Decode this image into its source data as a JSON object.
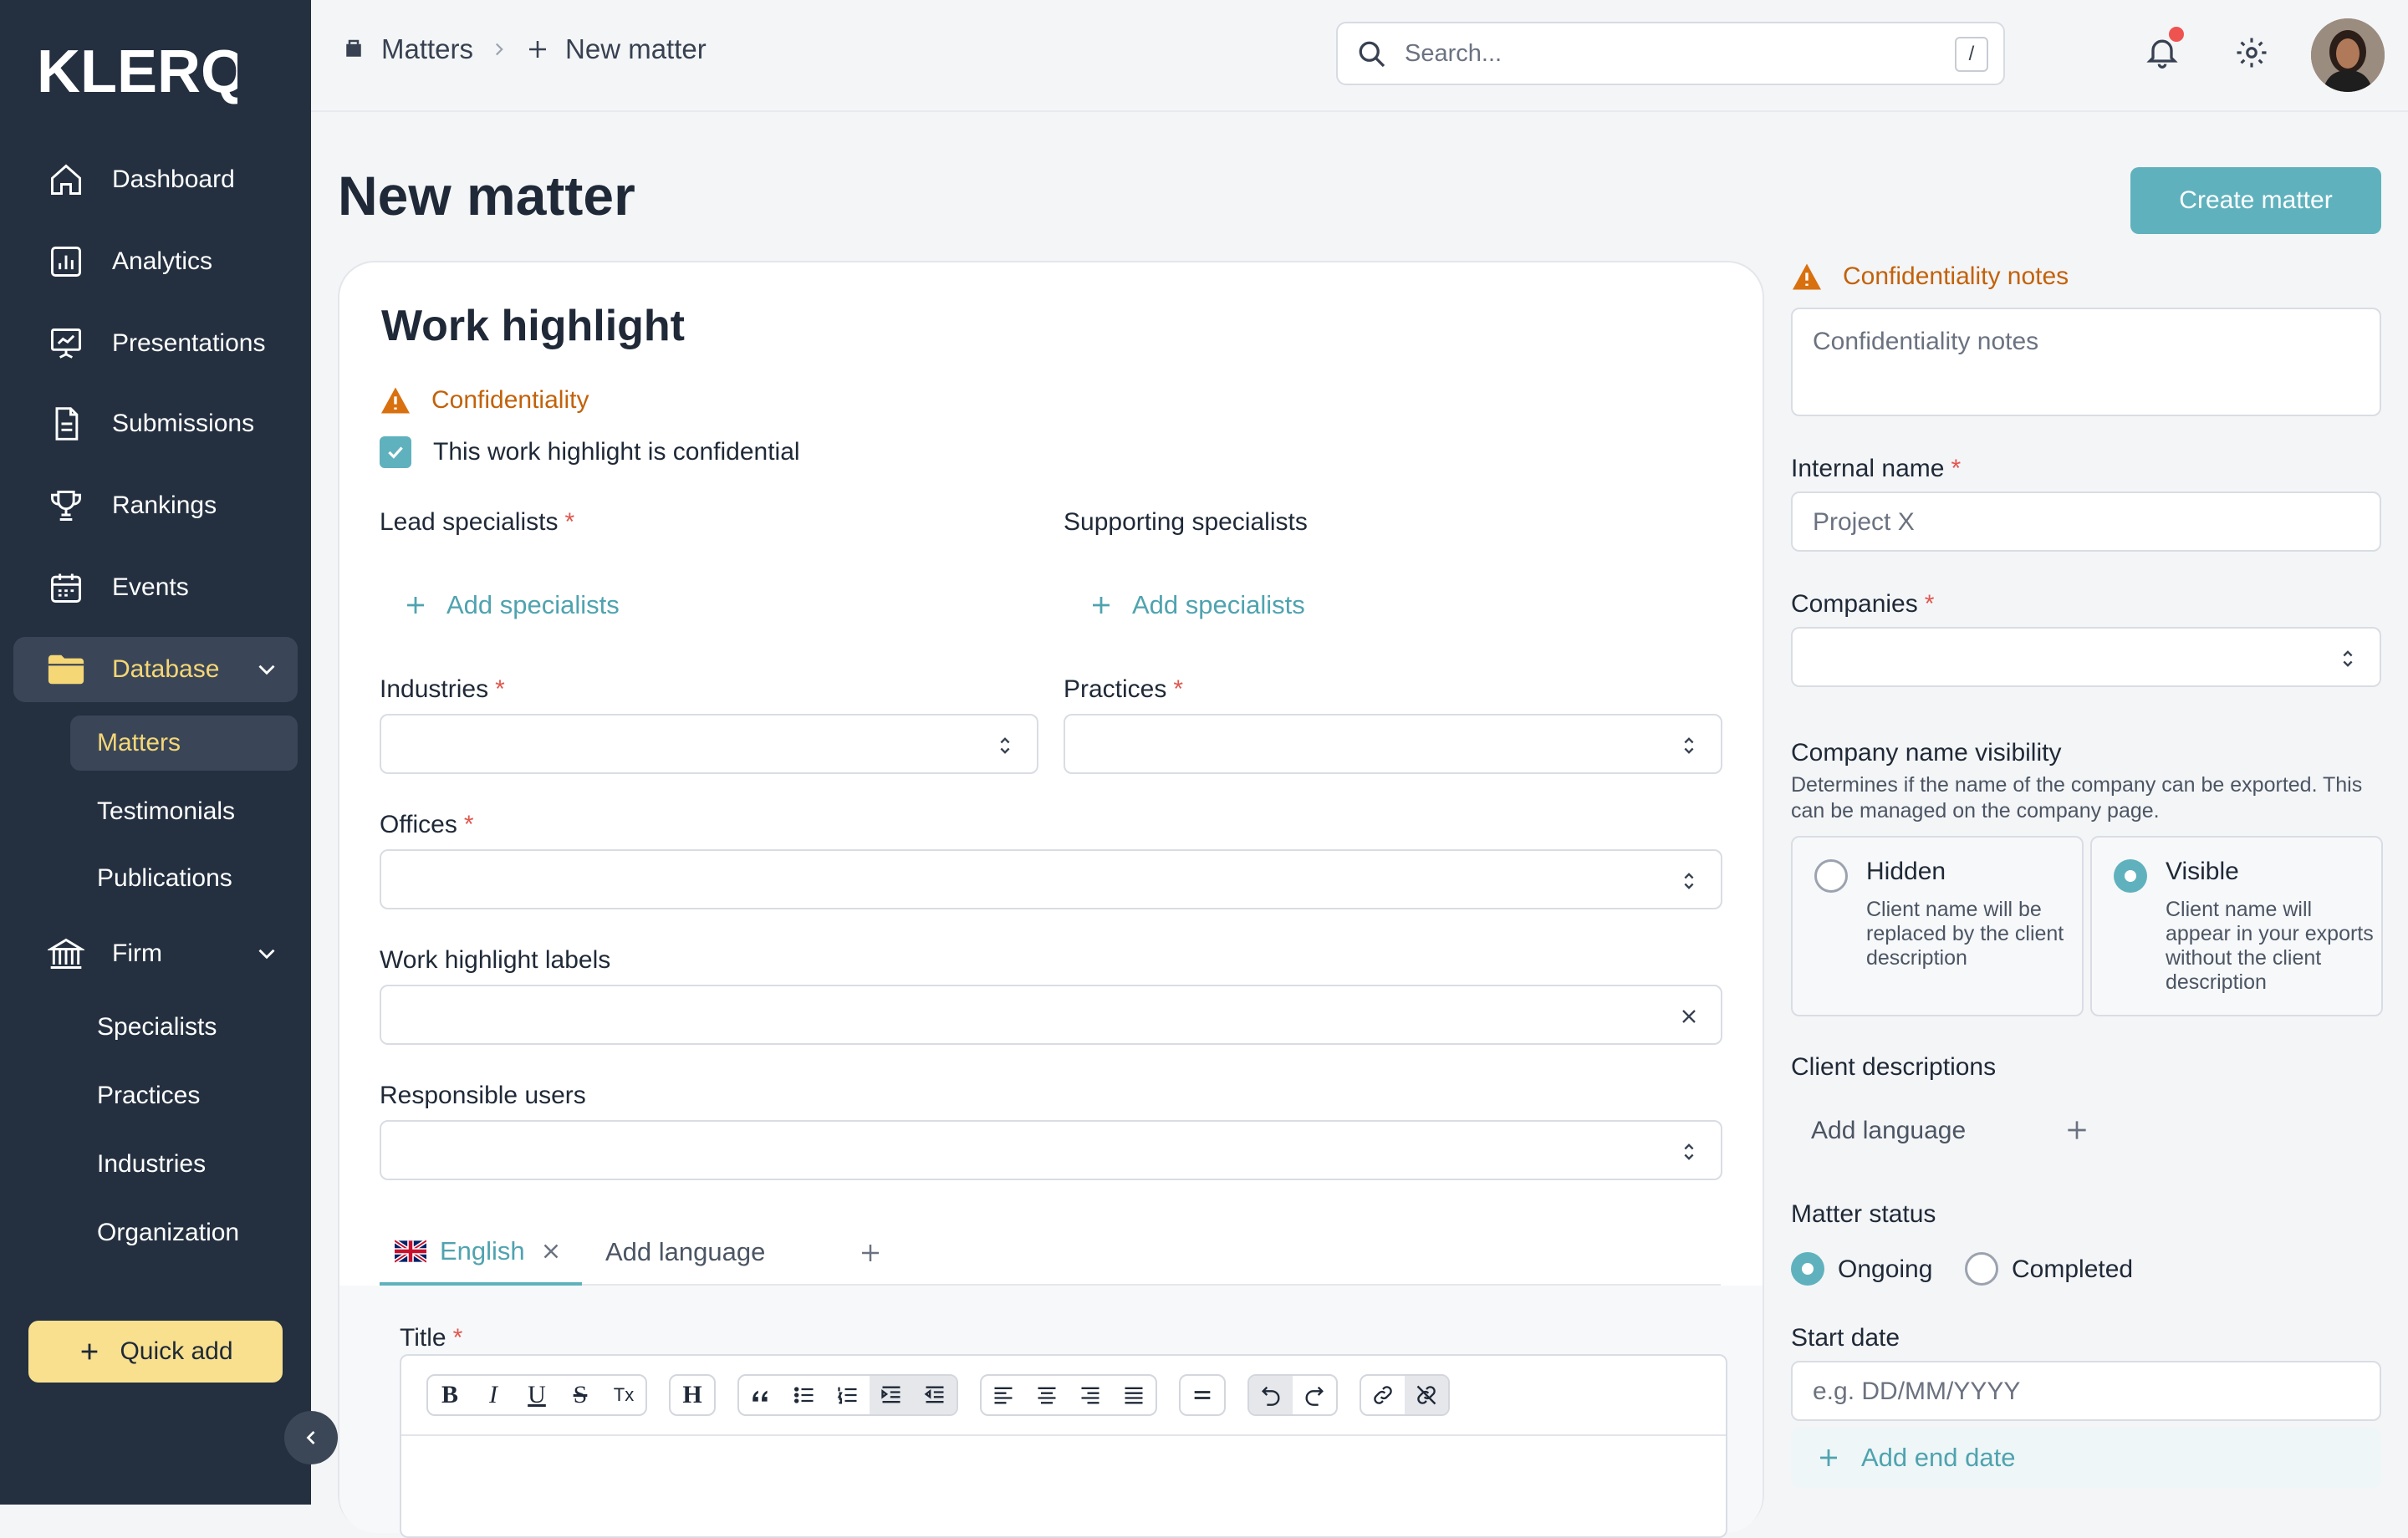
{
  "app": {
    "logo": "KLERQ"
  },
  "sidebar": {
    "items": [
      {
        "label": "Dashboard",
        "icon": "home-icon"
      },
      {
        "label": "Analytics",
        "icon": "analytics-icon"
      },
      {
        "label": "Presentations",
        "icon": "presentation-icon"
      },
      {
        "label": "Submissions",
        "icon": "document-icon"
      },
      {
        "label": "Rankings",
        "icon": "trophy-icon"
      },
      {
        "label": "Events",
        "icon": "calendar-icon"
      },
      {
        "label": "Database",
        "icon": "folder-icon"
      },
      {
        "label": "Firm",
        "icon": "bank-icon"
      }
    ],
    "database_sub": [
      "Matters",
      "Testimonials",
      "Publications"
    ],
    "firm_sub": [
      "Specialists",
      "Practices",
      "Industries",
      "Organization"
    ],
    "quick_add": "Quick add"
  },
  "breadcrumb": {
    "matters": "Matters",
    "new_matter": "New matter"
  },
  "search": {
    "placeholder": "Search...",
    "shortcut": "/"
  },
  "page": {
    "title": "New matter",
    "create_button": "Create matter"
  },
  "form": {
    "title": "Work highlight",
    "confidentiality": "Confidentiality",
    "confidential_checkbox": "This work highlight is confidential",
    "lead_specialists": "Lead specialists",
    "supporting_specialists": "Supporting specialists",
    "add_specialists": "Add specialists",
    "industries": "Industries",
    "practices": "Practices",
    "offices": "Offices",
    "work_highlight_labels": "Work highlight labels",
    "responsible_users": "Responsible users",
    "tab_english": "English",
    "add_language": "Add language",
    "title_label": "Title"
  },
  "editor_toolbar": [
    [
      "B",
      "I",
      "U",
      "S",
      "Tx"
    ],
    [
      "H"
    ],
    [
      "quote",
      "bullets",
      "numbers",
      "indent",
      "outdent"
    ],
    [
      "align-left",
      "align-center",
      "align-right",
      "justify"
    ],
    [
      "hr"
    ],
    [
      "undo",
      "redo"
    ],
    [
      "link",
      "unlink"
    ]
  ],
  "right_panel": {
    "confidentiality_notes_title": "Confidentiality notes",
    "confidentiality_notes_placeholder": "Confidentiality notes",
    "internal_name": "Internal name",
    "internal_name_placeholder": "Project X",
    "companies": "Companies",
    "company_name_visibility": "Company name visibility",
    "visibility_desc": "Determines if the name of the company can be exported. This can be managed on the company page.",
    "hidden_title": "Hidden",
    "hidden_desc": "Client name will be replaced by the client description",
    "visible_title": "Visible",
    "visible_desc": "Client name will appear in your exports without the client description",
    "selected_visibility": "Visible",
    "client_descriptions": "Client descriptions",
    "add_language": "Add language",
    "matter_status": "Matter status",
    "ongoing": "Ongoing",
    "completed": "Completed",
    "selected_status": "Ongoing",
    "start_date": "Start date",
    "start_date_placeholder": "e.g. DD/MM/YYYY",
    "add_end_date": "Add end date"
  },
  "colors": {
    "accent": "#5fb2bd",
    "sidebar": "#243040",
    "warning": "#c2620a",
    "highlight": "#f8e08e"
  }
}
